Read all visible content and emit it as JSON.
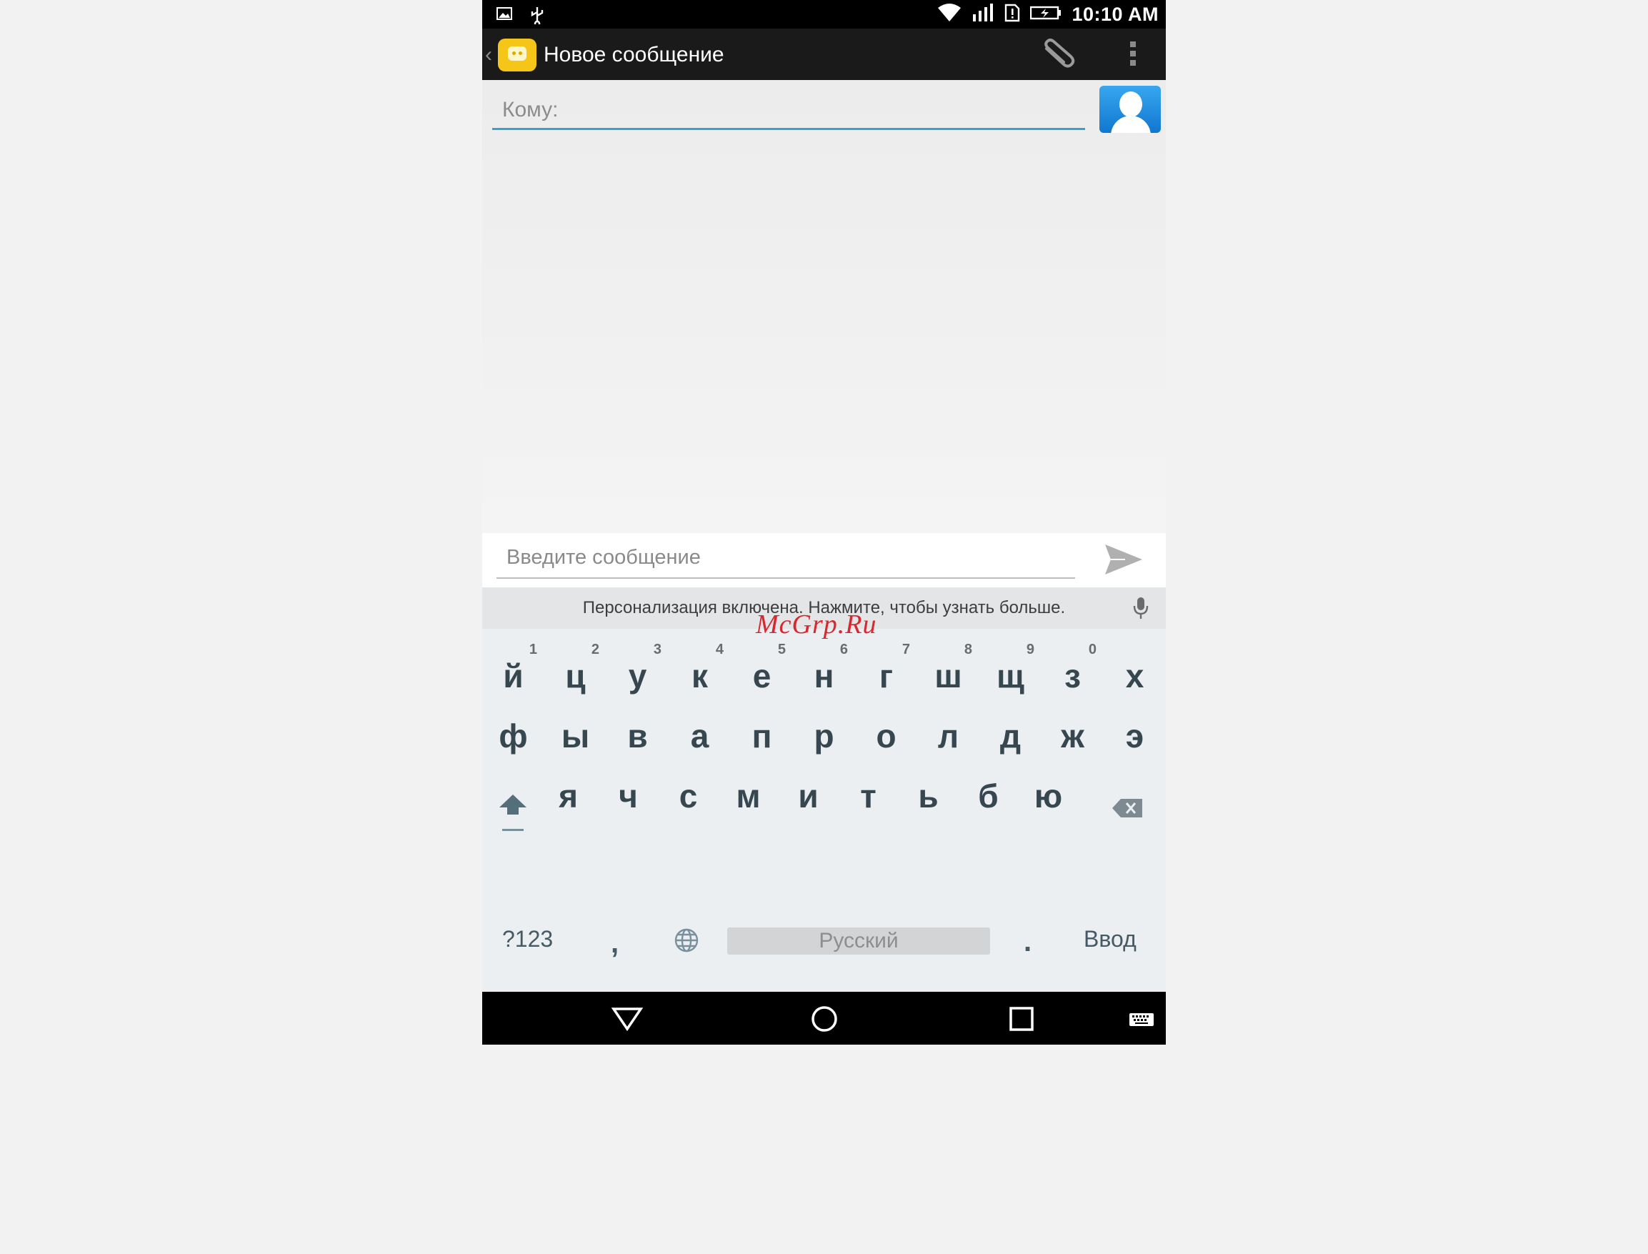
{
  "status_bar": {
    "time": "10:10 AM",
    "icons": [
      "image-icon",
      "usb-icon",
      "wifi-icon",
      "signal-3g-icon",
      "sim-alert-icon",
      "battery-charging-icon"
    ]
  },
  "action_bar": {
    "title": "Новое сообщение",
    "icons": [
      "back-caret-icon",
      "messaging-app-icon",
      "paperclip-icon",
      "overflow-menu-icon"
    ]
  },
  "recipient": {
    "placeholder": "Кому:",
    "value": "",
    "contact_button_icon": "contact-person-icon"
  },
  "compose": {
    "placeholder": "Введите сообщение",
    "value": "",
    "send_icon": "send-icon"
  },
  "keyboard": {
    "suggestion": "Персонализация включена. Нажмите, чтобы узнать больше.",
    "row1": [
      {
        "char": "й",
        "hint": "1"
      },
      {
        "char": "ц",
        "hint": "2"
      },
      {
        "char": "у",
        "hint": "3"
      },
      {
        "char": "к",
        "hint": "4"
      },
      {
        "char": "е",
        "hint": "5"
      },
      {
        "char": "н",
        "hint": "6"
      },
      {
        "char": "г",
        "hint": "7"
      },
      {
        "char": "ш",
        "hint": "8"
      },
      {
        "char": "щ",
        "hint": "9"
      },
      {
        "char": "з",
        "hint": "0"
      },
      {
        "char": "х",
        "hint": ""
      }
    ],
    "row2": [
      "ф",
      "ы",
      "в",
      "а",
      "п",
      "р",
      "о",
      "л",
      "д",
      "ж",
      "э"
    ],
    "row3": [
      "я",
      "ч",
      "с",
      "м",
      "и",
      "т",
      "ь",
      "б",
      "ю"
    ],
    "row4": {
      "symbols": "?123",
      "comma": ",",
      "space": "Русский",
      "period": ".",
      "enter": "Ввод"
    }
  },
  "nav_bar": {
    "icons": [
      "back-triangle-icon",
      "home-circle-icon",
      "recents-square-icon",
      "keyboard-icon"
    ]
  },
  "watermark": "McGrp.Ru",
  "colors": {
    "accent": "#39a3c7",
    "app_icon": "#f5c518",
    "contact_button": "#1a8ee0",
    "watermark": "#d7282f"
  }
}
